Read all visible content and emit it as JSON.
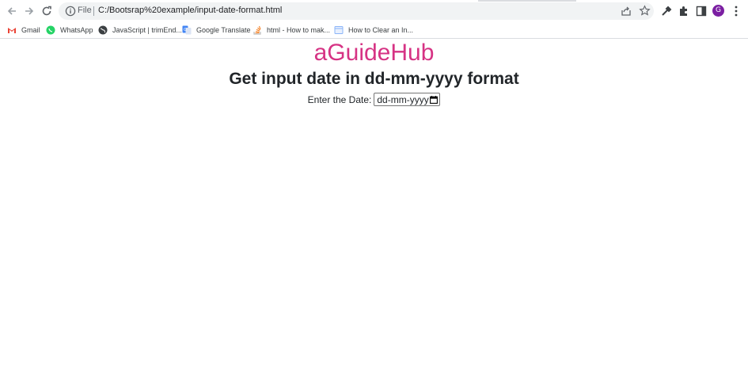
{
  "browser": {
    "scheme_label": "File",
    "url": "C:/Bootsrap%20example/input-date-format.html",
    "avatar_initial": "G",
    "avatar_color": "#7b1fa2"
  },
  "bookmarks": [
    {
      "label": "Gmail",
      "icon": "gmail-icon"
    },
    {
      "label": "WhatsApp",
      "icon": "whatsapp-icon"
    },
    {
      "label": "JavaScript | trimEnd...",
      "icon": "globe-icon"
    },
    {
      "label": "Google Translate",
      "icon": "translate-icon"
    },
    {
      "label": "html - How to mak...",
      "icon": "stackoverflow-icon"
    },
    {
      "label": "How to Clear an In...",
      "icon": "page-icon"
    }
  ],
  "page": {
    "title": "aGuideHub",
    "title_color": "#d63384",
    "heading": "Get input date in dd-mm-yyyy format",
    "date_label": "Enter the Date:",
    "date_placeholder": "dd-mm-yyyy"
  }
}
